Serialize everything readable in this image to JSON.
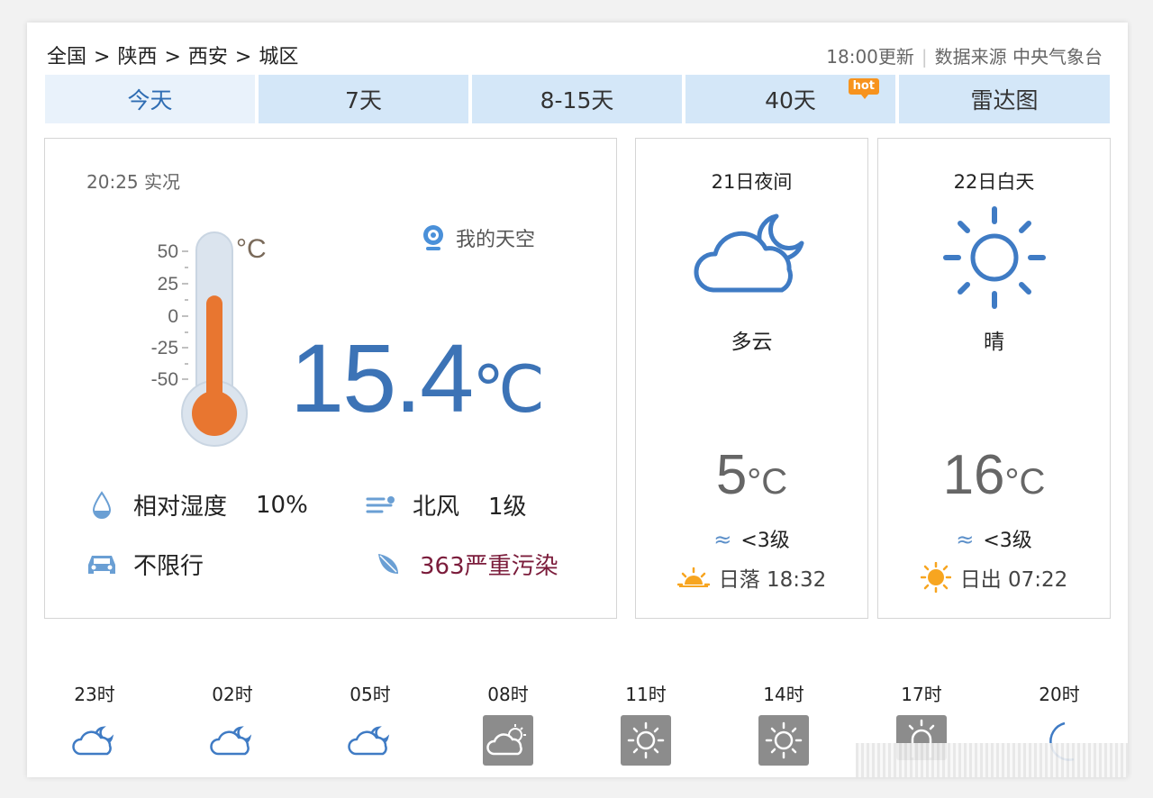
{
  "breadcrumb": [
    "全国",
    "陕西",
    "西安",
    "城区"
  ],
  "breadcrumb_sep": ">",
  "header": {
    "update_time": "18:00更新",
    "source": "数据来源 中央气象台"
  },
  "tabs": [
    {
      "label": "今天",
      "active": true
    },
    {
      "label": "7天",
      "active": false
    },
    {
      "label": "8-15天",
      "active": false
    },
    {
      "label": "40天",
      "active": false,
      "badge": "hot"
    },
    {
      "label": "雷达图",
      "active": false
    }
  ],
  "current": {
    "obs_time": "20:25 实况",
    "my_sky": "我的天空",
    "temperature": "15.4",
    "unit": "℃",
    "thermometer": {
      "ticks": [
        "50",
        "25",
        "0",
        "-25",
        "-50"
      ],
      "unit": "°C",
      "value": 15.4,
      "fill_color": "#e87630"
    },
    "humidity_label": "相对湿度",
    "humidity_value": "10%",
    "wind_dir": "北风",
    "wind_level": "1级",
    "traffic": "不限行",
    "aqi": "363严重污染",
    "icons": {
      "humidity": "droplet-icon",
      "wind": "wind-icon",
      "traffic": "car-icon",
      "aqi": "leaf-icon",
      "sky": "webcam-icon"
    }
  },
  "forecast": [
    {
      "period": "21日夜间",
      "icon": "cloudy-night-icon",
      "desc": "多云",
      "temp": "5",
      "unit": "°C",
      "wind": "<3级",
      "sun_label": "日落 18:32"
    },
    {
      "period": "22日白天",
      "icon": "sunny-icon",
      "desc": "晴",
      "temp": "16",
      "unit": "°C",
      "wind": "<3级",
      "sun_label": "日出 07:22"
    }
  ],
  "hourly": [
    {
      "time": "23时",
      "icon": "cloudy-night-icon"
    },
    {
      "time": "02时",
      "icon": "cloudy-night-icon"
    },
    {
      "time": "05时",
      "icon": "cloudy-night-icon"
    },
    {
      "time": "08时",
      "icon": "cloudy-day-icon"
    },
    {
      "time": "11时",
      "icon": "sunny-icon"
    },
    {
      "time": "14时",
      "icon": "sunny-icon"
    },
    {
      "time": "17时",
      "icon": "sunset-icon"
    },
    {
      "time": "20时",
      "icon": "moon-icon"
    }
  ],
  "colors": {
    "accent_blue": "#3c73b6",
    "tab_bg": "#d4e7f8",
    "tab_active_bg": "#e9f2fb",
    "hot": "#f7931e",
    "aqi": "#7b1c3b"
  }
}
